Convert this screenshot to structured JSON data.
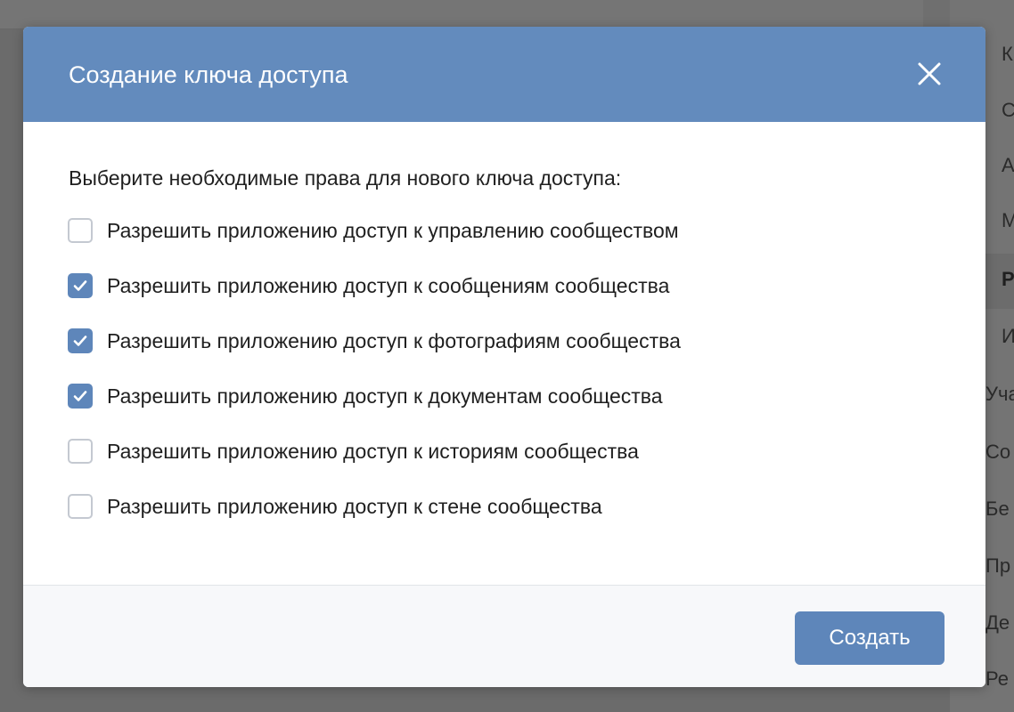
{
  "background": {
    "sidebar_items": [
      "К",
      "С",
      "А",
      "М",
      "Р",
      "И",
      "Уча",
      "Со",
      "Бе",
      "Пр",
      "Де",
      "Ре"
    ],
    "sidebar_active_index": 4
  },
  "modal": {
    "title": "Создание ключа доступа",
    "close_icon": "close-icon",
    "intro": "Выберите необходимые права для нового ключа доступа:",
    "options": [
      {
        "label": "Разрешить приложению доступ к управлению сообществом",
        "checked": false
      },
      {
        "label": "Разрешить приложению доступ к сообщениям сообщества",
        "checked": true
      },
      {
        "label": "Разрешить приложению доступ к фотографиям сообщества",
        "checked": true
      },
      {
        "label": "Разрешить приложению доступ к документам сообщества",
        "checked": true
      },
      {
        "label": "Разрешить приложению доступ к историям сообщества",
        "checked": false
      },
      {
        "label": "Разрешить приложению доступ к стене сообщества",
        "checked": false
      }
    ],
    "submit_label": "Создать"
  },
  "colors": {
    "header": "#638bbd",
    "accent": "#5e86ba",
    "overlay": "#6b6b6b"
  }
}
